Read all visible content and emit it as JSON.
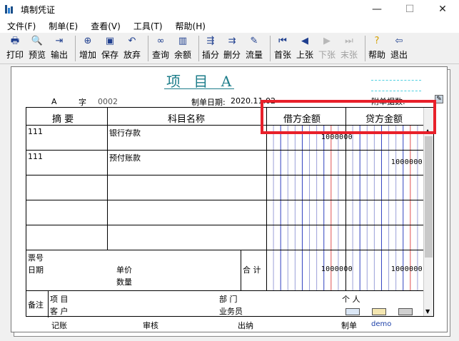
{
  "window": {
    "title": "填制凭证",
    "controls": {
      "minimize": "—",
      "maximize": "☐",
      "close": "✕"
    }
  },
  "menu": [
    "文件(F)",
    "制单(E)",
    "查看(V)",
    "工具(T)",
    "帮助(H)"
  ],
  "toolbar": [
    {
      "label": "打印",
      "icon": "print-icon",
      "enabled": true
    },
    {
      "label": "预览",
      "icon": "preview-icon",
      "enabled": true
    },
    {
      "label": "输出",
      "icon": "export-icon",
      "enabled": true
    },
    {
      "label": "增加",
      "icon": "add-icon",
      "enabled": true
    },
    {
      "label": "保存",
      "icon": "save-icon",
      "enabled": true
    },
    {
      "label": "放弃",
      "icon": "undo-icon",
      "enabled": true
    },
    {
      "label": "查询",
      "icon": "binoculars-icon",
      "enabled": true
    },
    {
      "label": "余额",
      "icon": "chart-icon",
      "enabled": true
    },
    {
      "label": "插分",
      "icon": "insert-row-icon",
      "enabled": true
    },
    {
      "label": "删分",
      "icon": "delete-row-icon",
      "enabled": true
    },
    {
      "label": "流量",
      "icon": "flow-icon",
      "enabled": true
    },
    {
      "label": "首张",
      "icon": "first-icon",
      "enabled": true
    },
    {
      "label": "上张",
      "icon": "prev-icon",
      "enabled": true
    },
    {
      "label": "下张",
      "icon": "next-icon",
      "enabled": false
    },
    {
      "label": "末张",
      "icon": "last-icon",
      "enabled": false
    },
    {
      "label": "帮助",
      "icon": "help-icon",
      "enabled": true
    },
    {
      "label": "退出",
      "icon": "exit-icon",
      "enabled": true
    }
  ],
  "voucher": {
    "title": "项 目 A",
    "word": "A",
    "word_label": "字",
    "number": "0002",
    "date_label": "制单日期:",
    "date": "2020.11.02",
    "attach_label": "附单据数:",
    "headers": {
      "summary": "摘 要",
      "subject": "科目名称",
      "debit": "借方金额",
      "credit": "贷方金额"
    },
    "rows": [
      {
        "summary": "111",
        "subject": "银行存款",
        "debit": "1000000",
        "credit": ""
      },
      {
        "summary": "111",
        "subject": "预付账款",
        "debit": "",
        "credit": "1000000"
      }
    ],
    "ticket_label": "票号",
    "date_row_label": "日期",
    "price_label": "单价",
    "qty_label": "数量",
    "total_label": "合 计",
    "total_debit": "1000000",
    "total_credit": "1000000",
    "remark_label": "备注",
    "project_label": "项 目",
    "customer_label": "客 户",
    "dept_label": "部 门",
    "person_label": "个 人",
    "sales_label": "业务员"
  },
  "footer": {
    "bookkeeping": "记账",
    "audit": "审核",
    "cashier": "出纳",
    "maker_label": "制单",
    "maker": "demo"
  },
  "colors": {
    "accent": "#1d7d8a",
    "highlight": "#e8202a",
    "grid_red": "#e05050",
    "grid_blue": "#3040c0"
  }
}
